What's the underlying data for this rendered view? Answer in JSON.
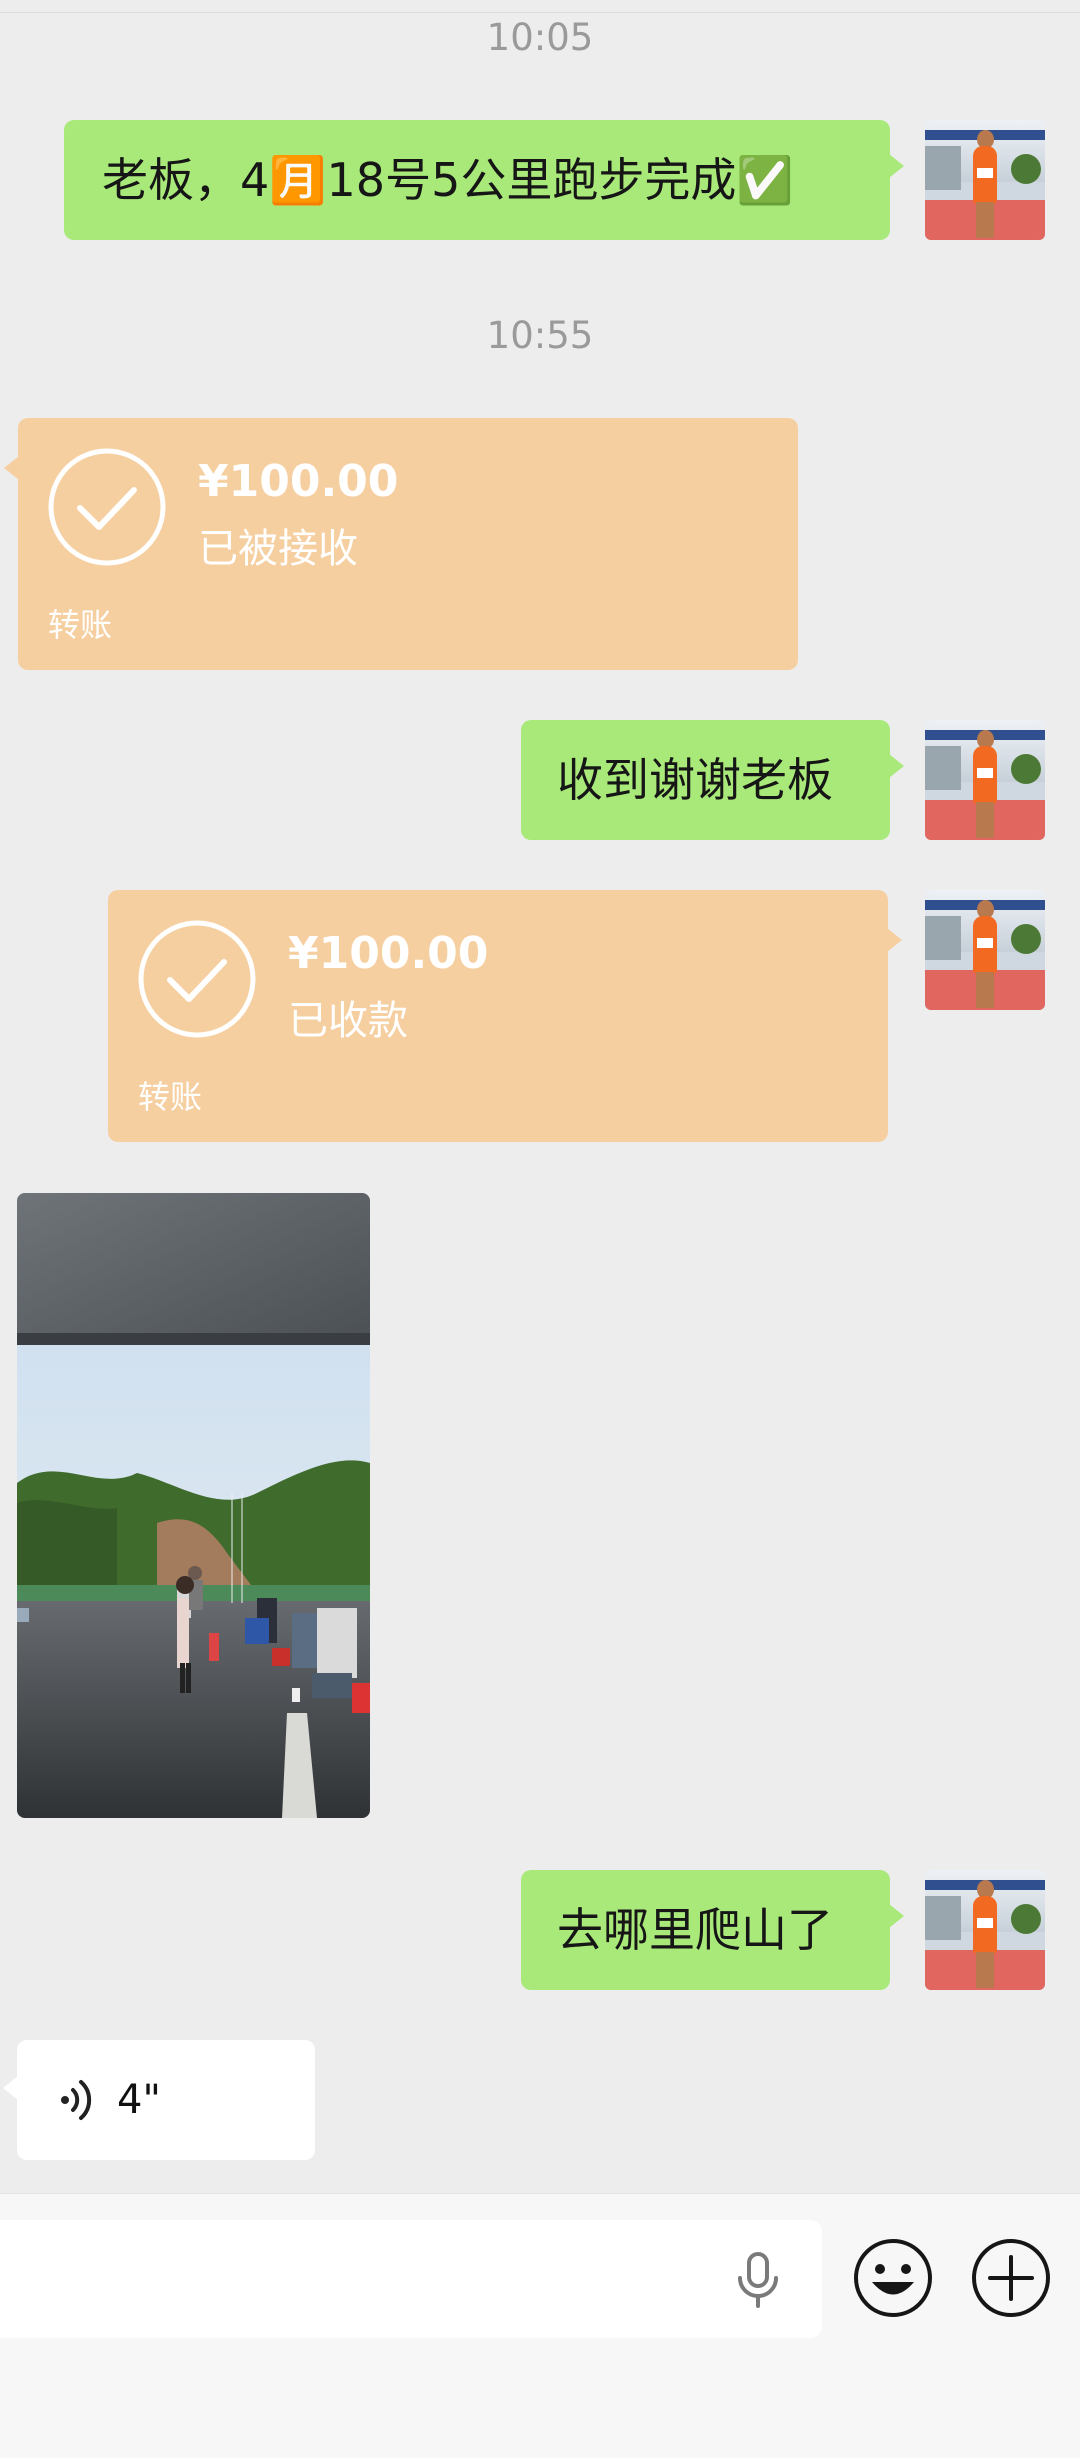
{
  "chat": {
    "time1": "10:05",
    "msg1": "老板，4🈷️18号5公里跑步完成✅",
    "time2": "10:55",
    "transfer1": {
      "amount": "¥100.00",
      "status": "已被接收",
      "label": "转账"
    },
    "msg2": "收到谢谢老板",
    "transfer2": {
      "amount": "¥100.00",
      "status": "已收款",
      "label": "转账"
    },
    "msg3": "去哪里爬山了",
    "voice": {
      "duration": "4\""
    }
  },
  "colors": {
    "background": "#ededed",
    "sent_bubble": "#a9e97a",
    "transfer_bubble": "#f6cfa0",
    "received_bubble": "#ffffff"
  },
  "icons": {
    "voice_input": "microphone-icon",
    "emoji": "smiley-icon",
    "more": "plus-circle-icon",
    "voice_msg": "sound-wave-icon",
    "transfer": "check-circle-icon"
  }
}
